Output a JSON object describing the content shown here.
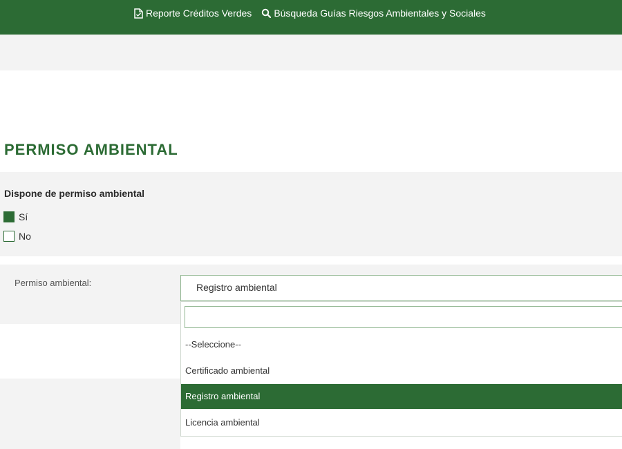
{
  "topbar": {
    "links": [
      {
        "label": "Reporte Créditos Verdes",
        "icon": "document-icon"
      },
      {
        "label": "Búsqueda Guías Riesgos Ambientales y Sociales",
        "icon": "search-icon"
      }
    ]
  },
  "section": {
    "title": "PERMISO AMBIENTAL"
  },
  "question": {
    "label": "Dispone de permiso ambiental",
    "options": [
      {
        "label": "Sí",
        "checked": true
      },
      {
        "label": "No",
        "checked": false
      }
    ]
  },
  "permit_field": {
    "label": "Permiso ambiental:",
    "selected_value": "Registro ambiental",
    "search_value": "",
    "options": [
      {
        "label": "--Seleccione--",
        "selected": false
      },
      {
        "label": "Certificado ambiental",
        "selected": false
      },
      {
        "label": "Registro ambiental",
        "selected": true
      },
      {
        "label": "Licencia ambiental",
        "selected": false
      }
    ]
  },
  "colors": {
    "brand_green": "#2c6b34",
    "panel_grey": "#f3f3f3"
  }
}
